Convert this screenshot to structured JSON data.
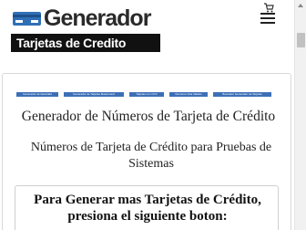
{
  "header": {
    "logo_title": "Generador",
    "logo_subtitle": "Tarjetas de Credito",
    "icons": [
      "credit-card-icon",
      "cart-icon",
      "hamburger-menu-icon"
    ]
  },
  "links": [
    "Generador de Identidad",
    "Generador de Tarjetas Mastercard",
    "Tarjetas con CCV",
    "Numeros Visa Validos",
    "Buscador Generador de Tarjetas"
  ],
  "main": {
    "title": "Generador de Números de Tarjeta de Crédito",
    "subtitle": "Números de Tarjeta de Crédito para Pruebas de Sistemas",
    "cta": "Para Generar mas Tarjetas de Crédito, presiona el siguiente boton:"
  },
  "colors": {
    "link_bg": "#3d6fb6",
    "logo_bg": "#111111",
    "card_icon": "#2f6fb5"
  }
}
